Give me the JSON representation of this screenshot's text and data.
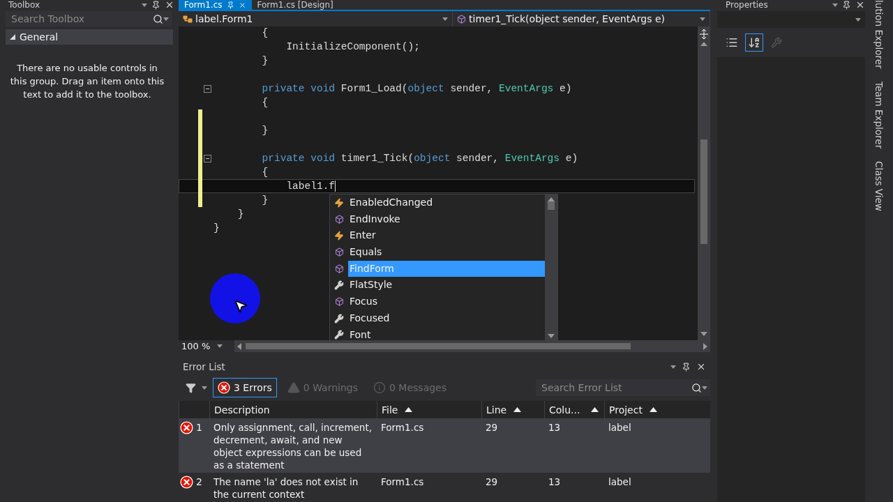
{
  "toolbox": {
    "title": "Toolbox",
    "search": {
      "placeholder": "Search Toolbox"
    },
    "group": {
      "label": "General",
      "expanded": true
    },
    "empty_message": "There are no usable controls in this group. Drag an item onto this text to add it to the toolbox."
  },
  "editor": {
    "tabs": [
      {
        "label": "Form1.cs",
        "selected": true
      },
      {
        "label": "Form1.cs [Design]",
        "selected": false
      }
    ],
    "nav": {
      "type_dropdown": "label.Form1",
      "member_dropdown": "timer1_Tick(object sender, EventArgs e)"
    },
    "lines": [
      {
        "tokens": [
          {
            "kind": "plain",
            "text": "        {"
          }
        ],
        "changed": false,
        "collapsible": false,
        "current": false
      },
      {
        "tokens": [
          {
            "kind": "plain",
            "text": "            InitializeComponent();"
          }
        ],
        "changed": false,
        "collapsible": false,
        "current": false
      },
      {
        "tokens": [
          {
            "kind": "plain",
            "text": "        }"
          }
        ],
        "changed": false,
        "collapsible": false,
        "current": false
      },
      {
        "changed": false,
        "collapsible": false,
        "current": false
      },
      {
        "tokens": [
          {
            "kind": "keyword",
            "text": "        private void "
          },
          {
            "kind": "plain",
            "text": "Form1_Load("
          },
          {
            "kind": "keyword",
            "text": "object "
          },
          {
            "kind": "plain",
            "text": "sender, "
          },
          {
            "kind": "type",
            "text": "EventArgs "
          },
          {
            "kind": "plain",
            "text": "e)"
          }
        ],
        "changed": false,
        "collapsible": true,
        "current": false
      },
      {
        "tokens": [
          {
            "kind": "plain",
            "text": "        {"
          }
        ],
        "changed": false,
        "collapsible": false,
        "current": false
      },
      {
        "changed": true,
        "collapsible": false,
        "current": false
      },
      {
        "tokens": [
          {
            "kind": "plain",
            "text": "        }"
          }
        ],
        "changed": true,
        "collapsible": false,
        "current": false
      },
      {
        "changed": true,
        "collapsible": false,
        "current": false
      },
      {
        "tokens": [
          {
            "kind": "keyword",
            "text": "        private void "
          },
          {
            "kind": "plain",
            "text": "timer1_Tick("
          },
          {
            "kind": "keyword",
            "text": "object "
          },
          {
            "kind": "plain",
            "text": "sender, "
          },
          {
            "kind": "type",
            "text": "EventArgs "
          },
          {
            "kind": "plain",
            "text": "e)"
          }
        ],
        "changed": true,
        "collapsible": true,
        "current": false
      },
      {
        "tokens": [
          {
            "kind": "plain",
            "text": "        {"
          }
        ],
        "changed": true,
        "collapsible": false,
        "current": false
      },
      {
        "tokens": [
          {
            "kind": "plain",
            "text": "            label1.f"
          }
        ],
        "changed": true,
        "collapsible": false,
        "current": true
      },
      {
        "tokens": [
          {
            "kind": "plain",
            "text": "        }"
          }
        ],
        "changed": true,
        "collapsible": false,
        "current": false
      },
      {
        "tokens": [
          {
            "kind": "plain",
            "text": "    }"
          }
        ],
        "changed": false,
        "collapsible": false,
        "current": false
      },
      {
        "tokens": [
          {
            "kind": "plain",
            "text": "}"
          }
        ],
        "changed": false,
        "collapsible": false,
        "current": false
      }
    ],
    "completion": [
      {
        "label": "EnabledChanged",
        "kind": "event",
        "selected": false
      },
      {
        "label": "EndInvoke",
        "kind": "method",
        "selected": false
      },
      {
        "label": "Enter",
        "kind": "event",
        "selected": false
      },
      {
        "label": "Equals",
        "kind": "method",
        "selected": false
      },
      {
        "label": "FindForm",
        "kind": "method",
        "selected": true
      },
      {
        "label": "FlatStyle",
        "kind": "property",
        "selected": false
      },
      {
        "label": "Focus",
        "kind": "method",
        "selected": false
      },
      {
        "label": "Focused",
        "kind": "property",
        "selected": false
      },
      {
        "label": "Font",
        "kind": "property",
        "selected": false
      }
    ],
    "zoom": "100 %"
  },
  "properties": {
    "title": "Properties",
    "buttons": [
      {
        "kind": "categorized",
        "selected": false,
        "disabled": false
      },
      {
        "kind": "alphabetical",
        "selected": true,
        "disabled": false
      },
      {
        "kind": "events",
        "selected": false,
        "disabled": true
      }
    ]
  },
  "side_tabs": [
    "lution Explorer",
    "Team Explorer",
    "Class View"
  ],
  "error_list": {
    "title": "Error List",
    "filters": [
      {
        "label": "3 Errors",
        "kind": "error",
        "selected": true
      },
      {
        "label": "0 Warnings",
        "kind": "warning",
        "selected": false
      },
      {
        "label": "0 Messages",
        "kind": "message",
        "selected": false
      }
    ],
    "search": {
      "placeholder": "Search Error List"
    },
    "columns": [
      {
        "label": "Description",
        "sorted": false
      },
      {
        "label": "File",
        "sorted": true
      },
      {
        "label": "Line",
        "sorted": true
      },
      {
        "label": "Colu...",
        "sorted": true
      },
      {
        "label": "Project",
        "sorted": true
      }
    ],
    "rows": [
      {
        "number": "1",
        "description": "Only assignment, call, increment, decrement, await, and new object expressions can be used as a statement",
        "file": "Form1.cs",
        "line": "29",
        "column": "13",
        "project": "label",
        "selected": true
      },
      {
        "number": "2",
        "description": "The name 'la' does not exist in the current context",
        "file": "Form1.cs",
        "line": "29",
        "column": "13",
        "project": "label",
        "selected": false
      }
    ]
  }
}
